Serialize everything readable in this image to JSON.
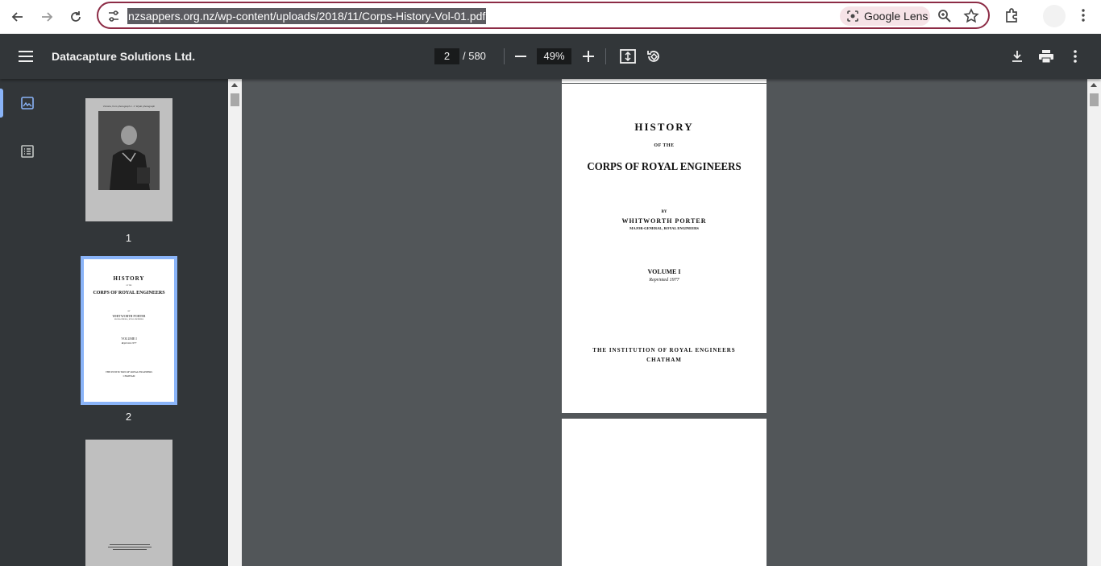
{
  "browser": {
    "url": "nzsappers.org.nz/wp-content/uploads/2018/11/Corps-History-Vol-01.pdf",
    "lens_label": "Google Lens"
  },
  "toolbar": {
    "title": "Datacapture Solutions Ltd.",
    "current_page": "2",
    "total_pages": "/ 580",
    "zoom": "49%"
  },
  "thumbnails": [
    {
      "label": "1",
      "caption": "Victoria, from photograph c. J. Wyatt photograph"
    },
    {
      "label": "2",
      "title": "HISTORY",
      "of": "OF THE",
      "corps": "CORPS OF ROYAL ENGINEERS",
      "by": "BY",
      "author": "WHITWORTH PORTER",
      "rank": "MAJOR-GENERAL, ROYAL ENGINEERS",
      "volume": "VOLUME I",
      "reprint": "Reprinted 1977",
      "publisher": "THE INSTITUTION OF ROYAL ENGINEERS",
      "place": "CHATHAM"
    }
  ],
  "page2": {
    "title": "HISTORY",
    "of": "OF THE",
    "corps": "CORPS OF ROYAL ENGINEERS",
    "by": "BY",
    "author": "WHITWORTH PORTER",
    "rank": "MAJOR-GENERAL, ROYAL ENGINEERS",
    "volume": "VOLUME I",
    "reprint": "Reprinted 1977",
    "publisher": "THE INSTITUTION OF ROYAL ENGINEERS",
    "place": "CHATHAM"
  },
  "colors": {
    "accent": "#8ab4f8",
    "toolbar_bg": "#323639",
    "viewer_bg": "#525659",
    "omnibox_border": "#8c2b45"
  }
}
